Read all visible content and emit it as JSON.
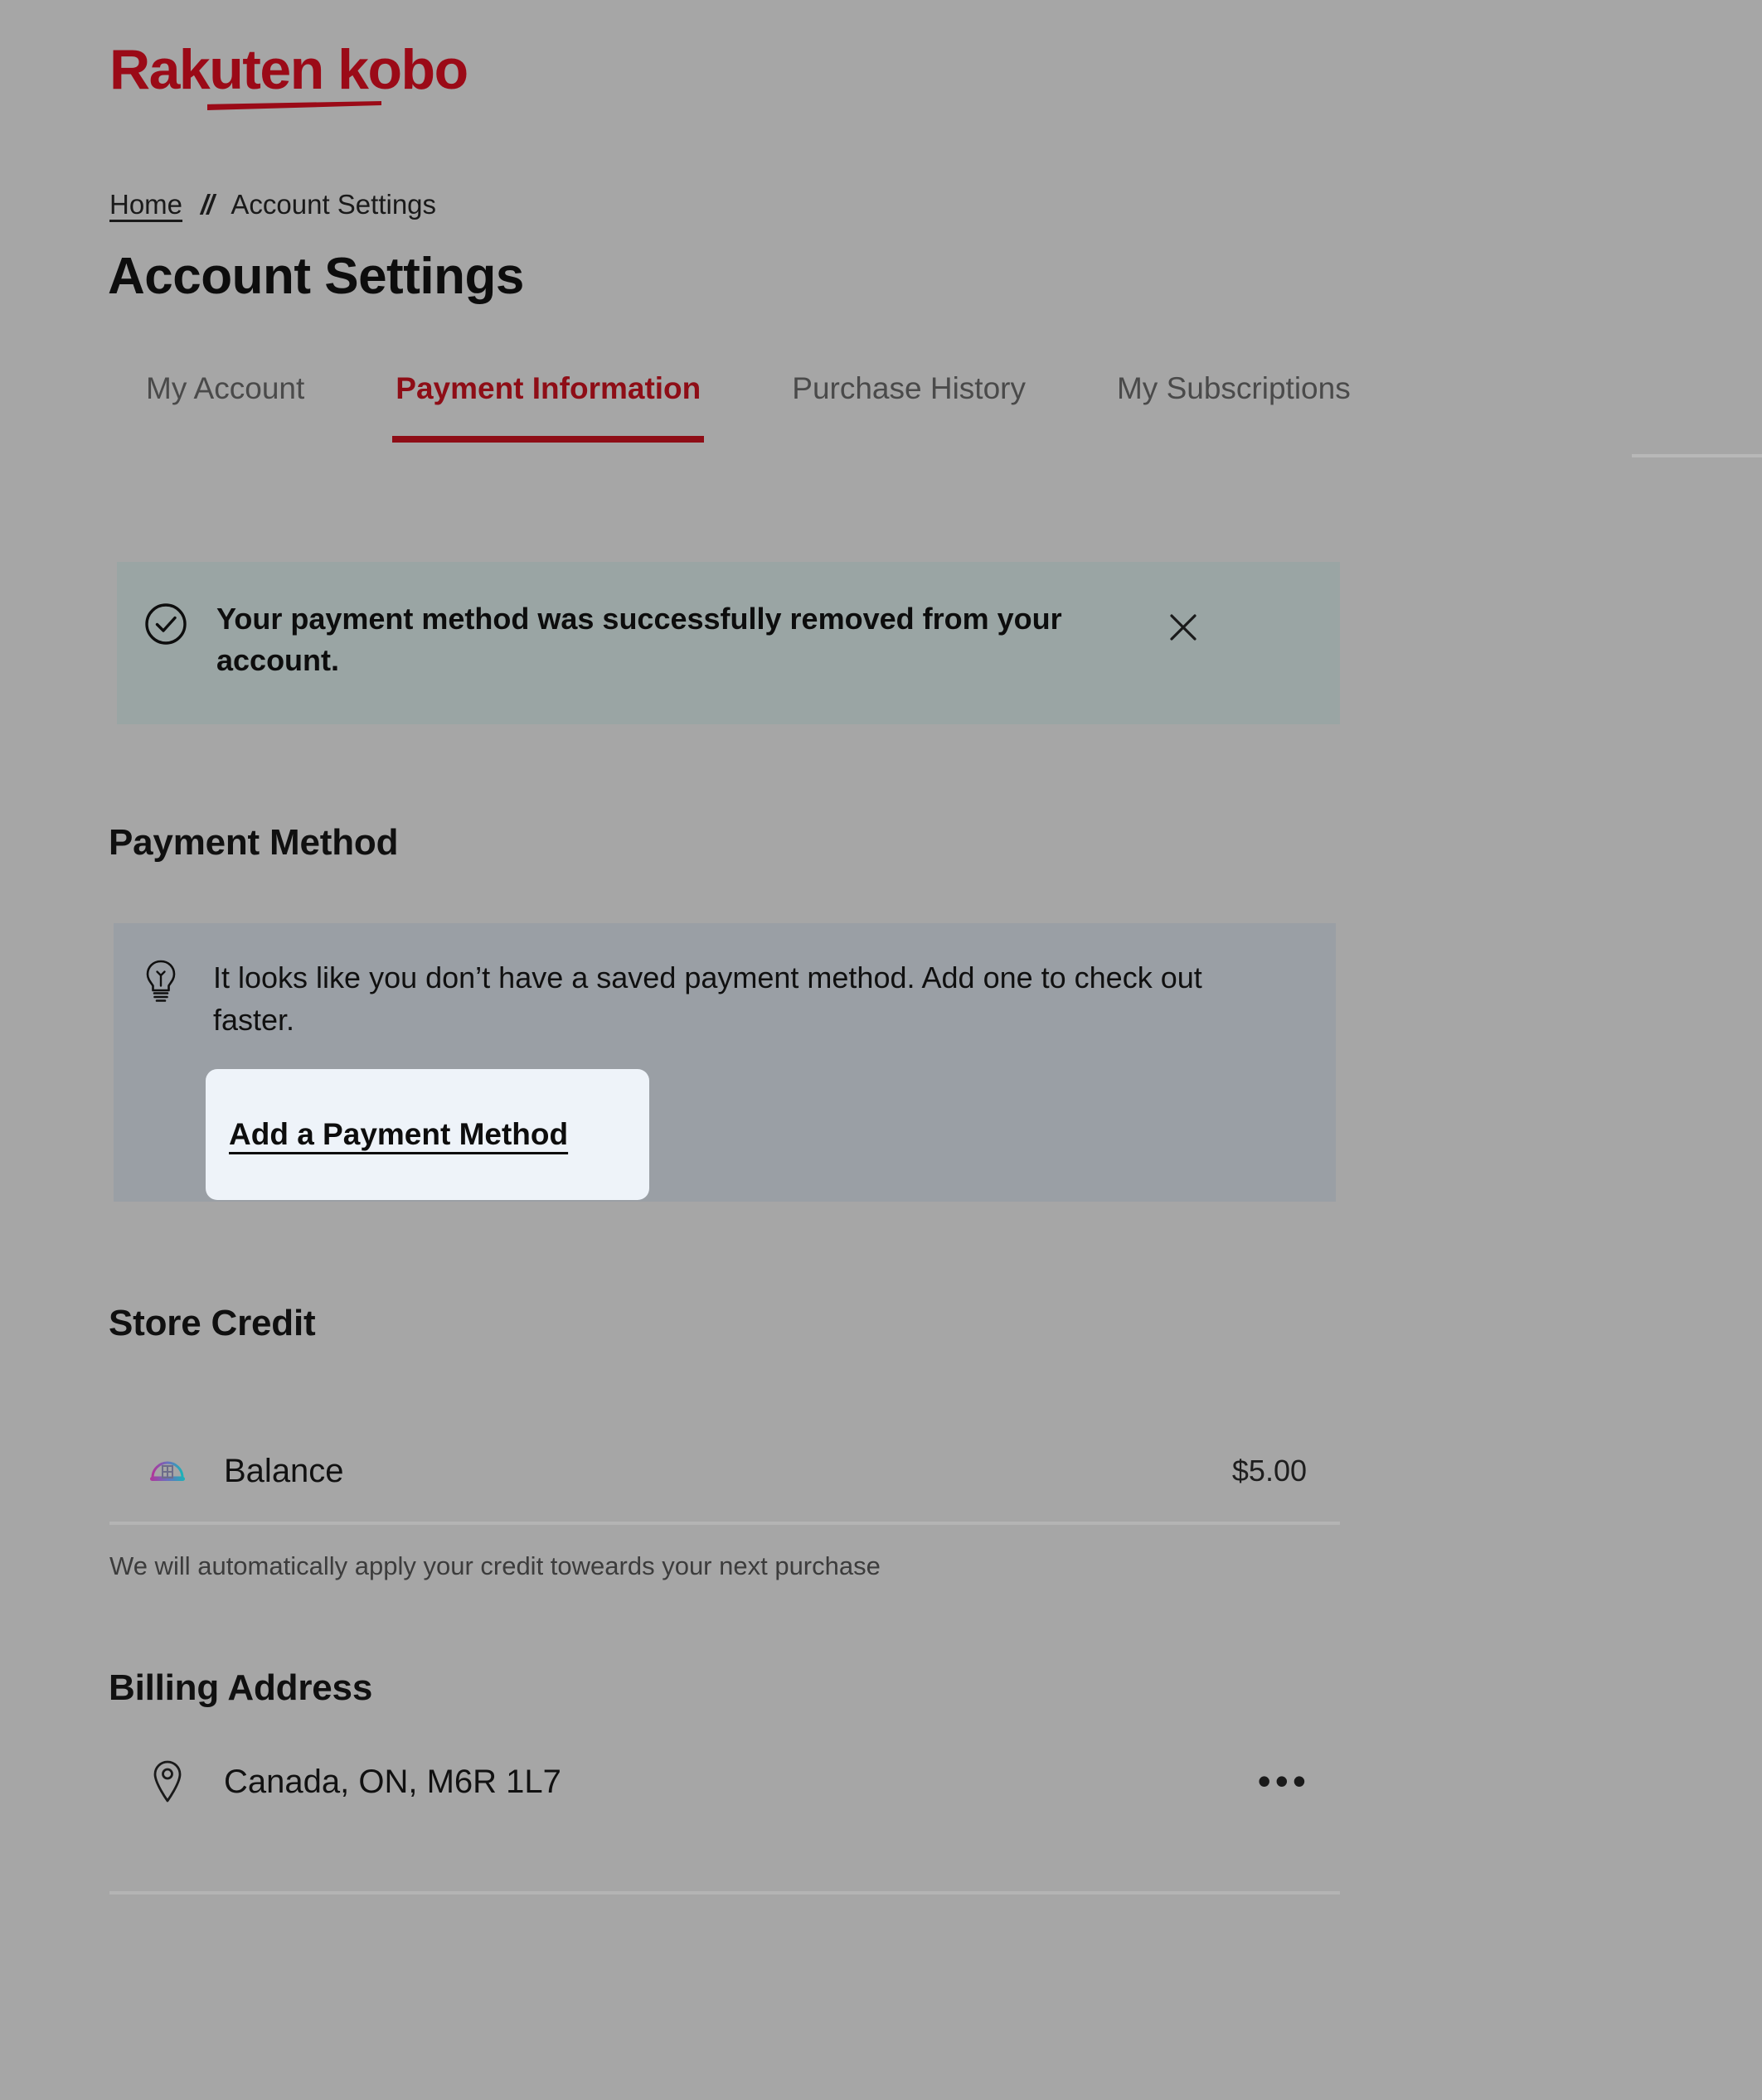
{
  "brand": {
    "logo_text": "Rakuten kobo",
    "logo_color": "#9b0a17"
  },
  "breadcrumb": {
    "home_label": "Home",
    "separator": "//",
    "current_label": "Account Settings"
  },
  "page": {
    "title": "Account Settings"
  },
  "tabs": [
    {
      "label": "My Account",
      "active": false
    },
    {
      "label": "Payment Information",
      "active": true
    },
    {
      "label": "Purchase History",
      "active": false
    },
    {
      "label": "My Subscriptions",
      "active": false
    }
  ],
  "banner": {
    "icon": "check-circle-icon",
    "message": "Your payment method was successfully removed from your account.",
    "close_icon": "close-icon",
    "background_color": "#9aa5a4"
  },
  "payment_method": {
    "heading": "Payment Method",
    "icon": "lightbulb-icon",
    "empty_message": "It looks like you don’t have a saved payment method. Add one to check out faster.",
    "add_button_label": "Add a Payment Method",
    "card_background_color": "#9a9fa5",
    "button_background_color": "#eef3f9"
  },
  "store_credit": {
    "heading": "Store Credit",
    "icon": "wallet-icon",
    "balance_label": "Balance",
    "balance_amount": "$5.00",
    "helper_text": "We will automatically apply your credit toweards your next purchase"
  },
  "billing_address": {
    "heading": "Billing Address",
    "icon": "map-pin-icon",
    "address": "Canada, ON, M6R 1L7",
    "menu_label": "•••"
  }
}
